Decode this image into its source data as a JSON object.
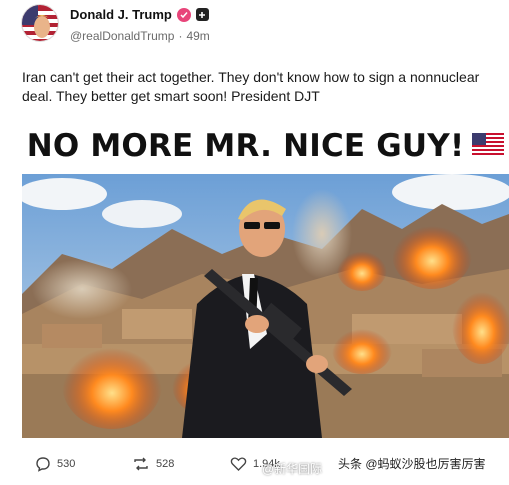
{
  "author": {
    "name": "Donald J. Trump",
    "handle": "@realDonaldTrump",
    "separator": "·",
    "time": "49m"
  },
  "post": {
    "text": "Iran can't get their act together. They don't know how to sign a nonnuclear deal. They better get smart soon! President DJT"
  },
  "media": {
    "banner_text": "NO MORE MR. NICE GUY!",
    "flag_icon": "us-flag-icon"
  },
  "actions": {
    "replies": "530",
    "reposts": "528",
    "likes": "1.94k"
  },
  "watermarks": {
    "center": "@新华国际",
    "right": "头条 @蚂蚁沙股也厉害厉害"
  },
  "colors": {
    "verified_badge": "#e8457a",
    "text_primary": "#111111",
    "text_secondary": "#6b6b6b"
  }
}
